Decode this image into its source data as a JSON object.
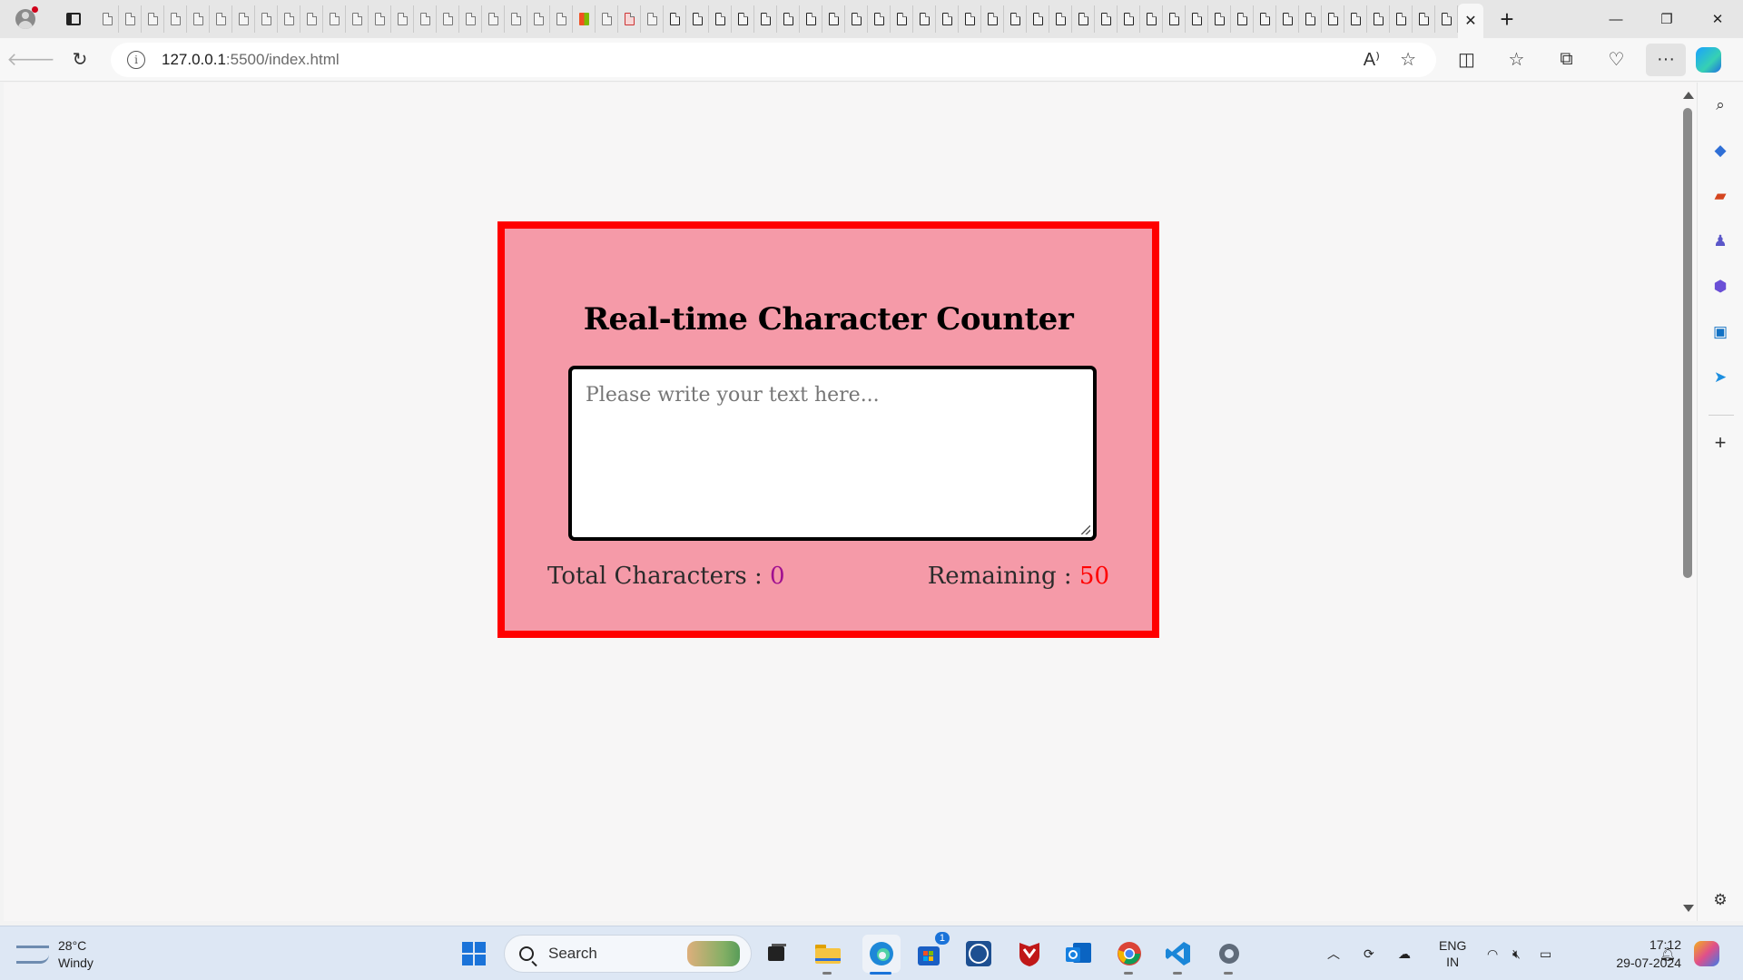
{
  "browser": {
    "tab_close_glyph": "✕",
    "new_tab_glyph": "+",
    "address": {
      "host": "127.0.0.1",
      "path": ":5500/index.html"
    },
    "window_controls": {
      "minimize": "—",
      "restore": "❐",
      "close": "✕"
    },
    "toolbar_more": "···"
  },
  "page": {
    "heading": "Real-time Character Counter",
    "textarea_placeholder": "Please write your text here...",
    "total_label": "Total Characters : ",
    "total_value": "0",
    "remaining_label": "Remaining : ",
    "remaining_value": "50",
    "colors": {
      "card_bg": "#f59aa8",
      "card_border": "#ff0000",
      "total_value": "#a01090",
      "remaining_value": "#ff0000"
    }
  },
  "taskbar": {
    "weather_temp": "28°C",
    "weather_desc": "Windy",
    "search_label": "Search",
    "store_badge": "1",
    "lang_top": "ENG",
    "lang_bottom": "IN",
    "time": "17:12",
    "date": "29-07-2024"
  }
}
